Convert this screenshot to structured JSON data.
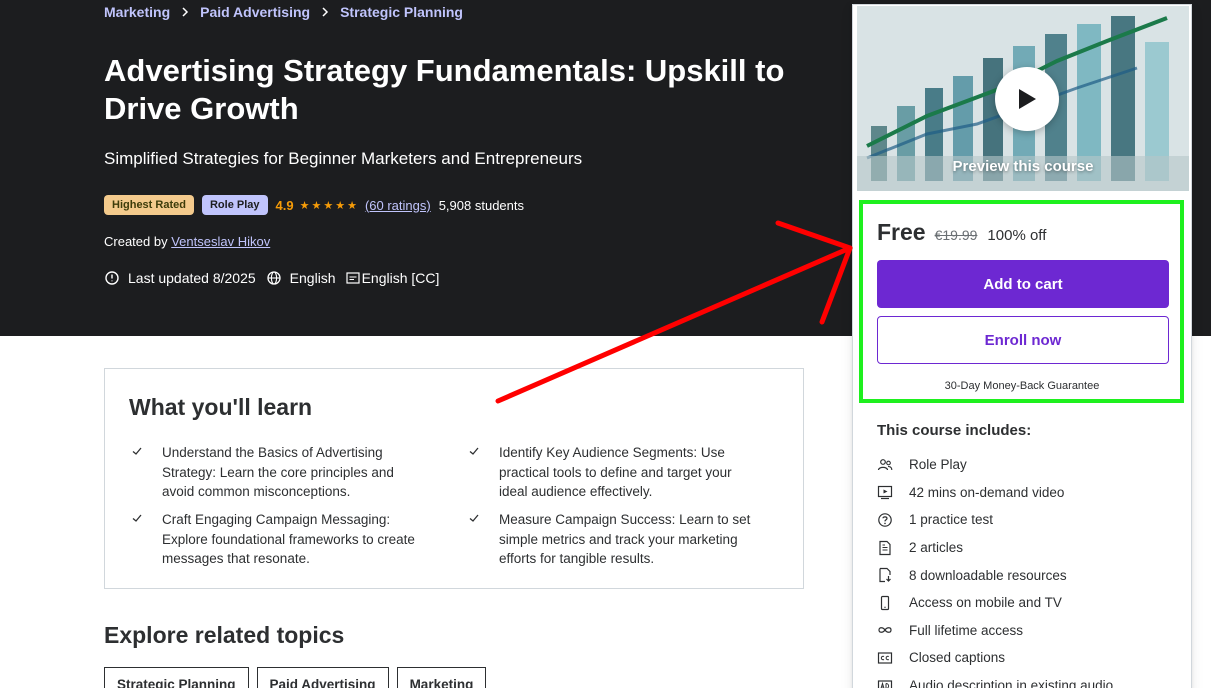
{
  "breadcrumb": [
    "Marketing",
    "Paid Advertising",
    "Strategic Planning"
  ],
  "course": {
    "title": "Advertising Strategy Fundamentals: Upskill to Drive Growth",
    "subtitle": "Simplified Strategies for Beginner Marketers and Entrepreneurs",
    "badge_highest": "Highest Rated",
    "badge_role": "Role Play",
    "rating": "4.9",
    "stars_filled": 5,
    "ratings_link": "(60 ratings)",
    "students": "5,908 students",
    "created_by_label": "Created by",
    "author": "Ventseslav Hikov",
    "last_updated": "Last updated 8/2025",
    "language": "English",
    "captions": "English [CC]"
  },
  "learn": {
    "title": "What you'll learn",
    "items": [
      "Understand the Basics of Advertising Strategy: Learn the core principles and avoid common misconceptions.",
      "Identify Key Audience Segments: Use practical tools to define and target your ideal audience effectively.",
      "Craft Engaging Campaign Messaging: Explore foundational frameworks to create messages that resonate.",
      "Measure Campaign Success: Learn to set simple metrics and track your marketing efforts for tangible results."
    ]
  },
  "explore": {
    "title": "Explore related topics",
    "topics": [
      "Strategic Planning",
      "Paid Advertising",
      "Marketing"
    ]
  },
  "sidebar": {
    "preview_label": "Preview this course",
    "price_free": "Free",
    "price_original": "€19.99",
    "price_discount": "100% off",
    "add_to_cart": "Add to cart",
    "enroll_now": "Enroll now",
    "guarantee": "30-Day Money-Back Guarantee",
    "includes_title": "This course includes:",
    "includes": [
      {
        "icon": "people-icon",
        "label": "Role Play"
      },
      {
        "icon": "video-icon",
        "label": "42 mins on-demand video"
      },
      {
        "icon": "question-icon",
        "label": "1 practice test"
      },
      {
        "icon": "article-icon",
        "label": "2 articles"
      },
      {
        "icon": "download-file-icon",
        "label": "8 downloadable resources"
      },
      {
        "icon": "mobile-icon",
        "label": "Access on mobile and TV"
      },
      {
        "icon": "infinity-icon",
        "label": "Full lifetime access"
      },
      {
        "icon": "cc-icon",
        "label": "Closed captions"
      },
      {
        "icon": "audio-description-icon",
        "label": "Audio description in existing audio"
      }
    ]
  },
  "colors": {
    "hero_bg": "#1c1d1f",
    "link_purple": "#c0c4fc",
    "star_orange": "#f69c08",
    "cta_purple": "#6d28d2",
    "annotation_red": "#ff0000",
    "annotation_green": "#1ef01e"
  }
}
